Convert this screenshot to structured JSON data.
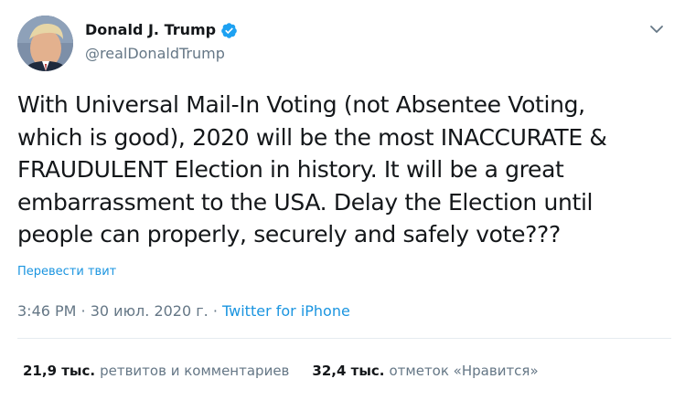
{
  "author": {
    "name": "Donald J. Trump",
    "handle": "@realDonaldTrump",
    "verified": true
  },
  "tweet": {
    "text": "With Universal Mail-In Voting (not Absentee Voting,\nwhich is good), 2020 will be the most INACCURATE &\nFRAUDULENT Election in history. It will be a great\nembarrassment to the USA. Delay the Election until\npeople can properly, securely and safely vote???",
    "translate_label": "Перевести твит"
  },
  "meta": {
    "time": "3:46 PM",
    "separator": " · ",
    "date": "30 июл. 2020 г.",
    "separator2": " · ",
    "source": "Twitter for iPhone"
  },
  "stats": {
    "retweets_count": "21,9 тыс.",
    "retweets_label": "ретвитов и комментариев",
    "likes_count": "32,4 тыс.",
    "likes_label": "отметок «Нравится»"
  },
  "colors": {
    "accent": "#1b95e0",
    "verified": "#1da1f2",
    "secondary_text": "#657786",
    "divider": "#e6ecf0"
  },
  "icons": {
    "verified": "verified-badge-icon",
    "caret": "chevron-down-icon"
  }
}
